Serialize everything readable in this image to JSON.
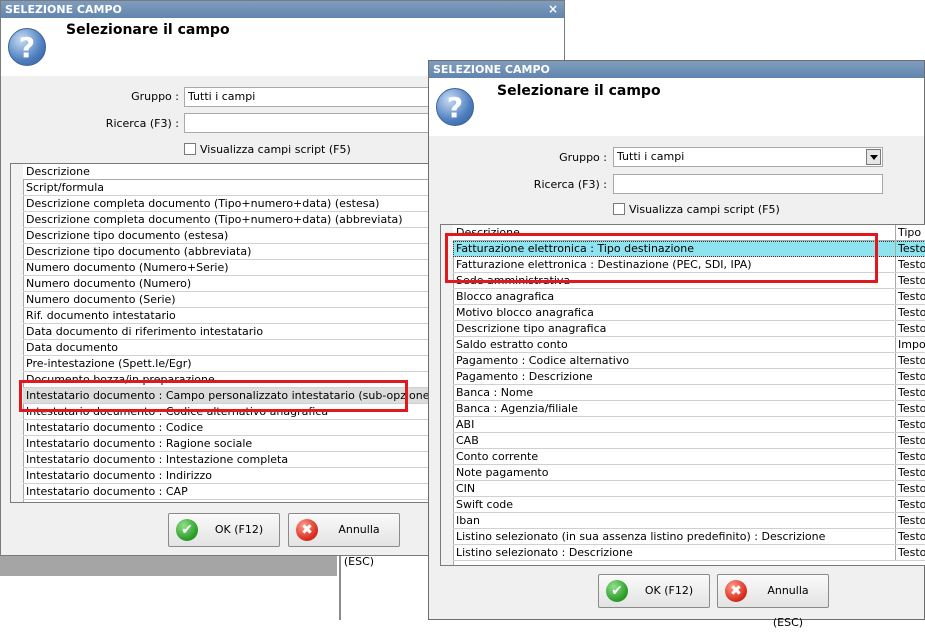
{
  "colors": {
    "titlebar": "#6285ae",
    "highlight": "#8fe3ef",
    "redbox": "#e2181f"
  },
  "dialog1": {
    "title": "SELEZIONE CAMPO",
    "close": "×",
    "heading": "Selezionare il campo",
    "group_label": "Gruppo :",
    "group_value": "Tutti i campi",
    "search_label": "Ricerca (F3) :",
    "search_value": "",
    "checkbox_label": "Visualizza campi script (F5)",
    "column_header": "Descrizione",
    "rows": [
      "Script/formula",
      "Descrizione completa documento (Tipo+numero+data) (estesa)",
      "Descrizione completa documento (Tipo+numero+data) (abbreviata)",
      "Descrizione tipo documento (estesa)",
      "Descrizione tipo documento (abbreviata)",
      "Numero documento (Numero+Serie)",
      "Numero documento (Numero)",
      "Numero documento (Serie)",
      "Rif. documento intestatario",
      "Data documento di riferimento intestatario",
      "Data documento",
      "Pre-intestazione (Spett.le/Egr)",
      "Documento bozza/in preparazione",
      "Intestatario documento : Campo personalizzato intestatario (sub-opzione)",
      "Intestatario documento : Codice alternativo anagrafica",
      "Intestatario documento : Codice",
      "Intestatario documento : Ragione sociale",
      "Intestatario documento : Intestazione completa",
      "Intestatario documento : Indirizzo",
      "Intestatario documento : CAP"
    ],
    "ok_label": "OK (F12)",
    "cancel_label": "Annulla (ESC)"
  },
  "dialog2": {
    "title": "SELEZIONE CAMPO",
    "heading": "Selezionare il campo",
    "group_label": "Gruppo :",
    "group_value": "Tutti i campi",
    "search_label": "Ricerca (F3) :",
    "search_value": "",
    "checkbox_label": "Visualizza campi script (F5)",
    "column_header": "Descrizione",
    "type_header": "Tipo",
    "rows": [
      {
        "desc": "Fatturazione elettronica : Tipo destinazione",
        "type": "Testo"
      },
      {
        "desc": "Fatturazione elettronica : Destinazione (PEC, SDI, IPA)",
        "type": "Testo"
      },
      {
        "desc": "Sede amministrativa",
        "type": "Testo"
      },
      {
        "desc": "Blocco anagrafica",
        "type": "Testo"
      },
      {
        "desc": "Motivo blocco anagrafica",
        "type": "Testo"
      },
      {
        "desc": "Descrizione tipo anagrafica",
        "type": "Testo"
      },
      {
        "desc": "Saldo estratto conto",
        "type": "Impor"
      },
      {
        "desc": "Pagamento : Codice alternativo",
        "type": "Testo"
      },
      {
        "desc": "Pagamento : Descrizione",
        "type": "Testo"
      },
      {
        "desc": "Banca : Nome",
        "type": "Testo"
      },
      {
        "desc": "Banca : Agenzia/filiale",
        "type": "Testo"
      },
      {
        "desc": "ABI",
        "type": "Testo"
      },
      {
        "desc": "CAB",
        "type": "Testo"
      },
      {
        "desc": "Conto corrente",
        "type": "Testo"
      },
      {
        "desc": "Note pagamento",
        "type": "Testo"
      },
      {
        "desc": "CIN",
        "type": "Testo"
      },
      {
        "desc": "Swift code",
        "type": "Testo"
      },
      {
        "desc": "Iban",
        "type": "Testo"
      },
      {
        "desc": "Listino selezionato (in sua assenza listino predefinito) : Descrizione",
        "type": "Testo"
      },
      {
        "desc": "Listino selezionato : Descrizione",
        "type": "Testo"
      }
    ],
    "ok_label": "OK (F12)",
    "cancel_label": "Annulla (ESC)"
  }
}
